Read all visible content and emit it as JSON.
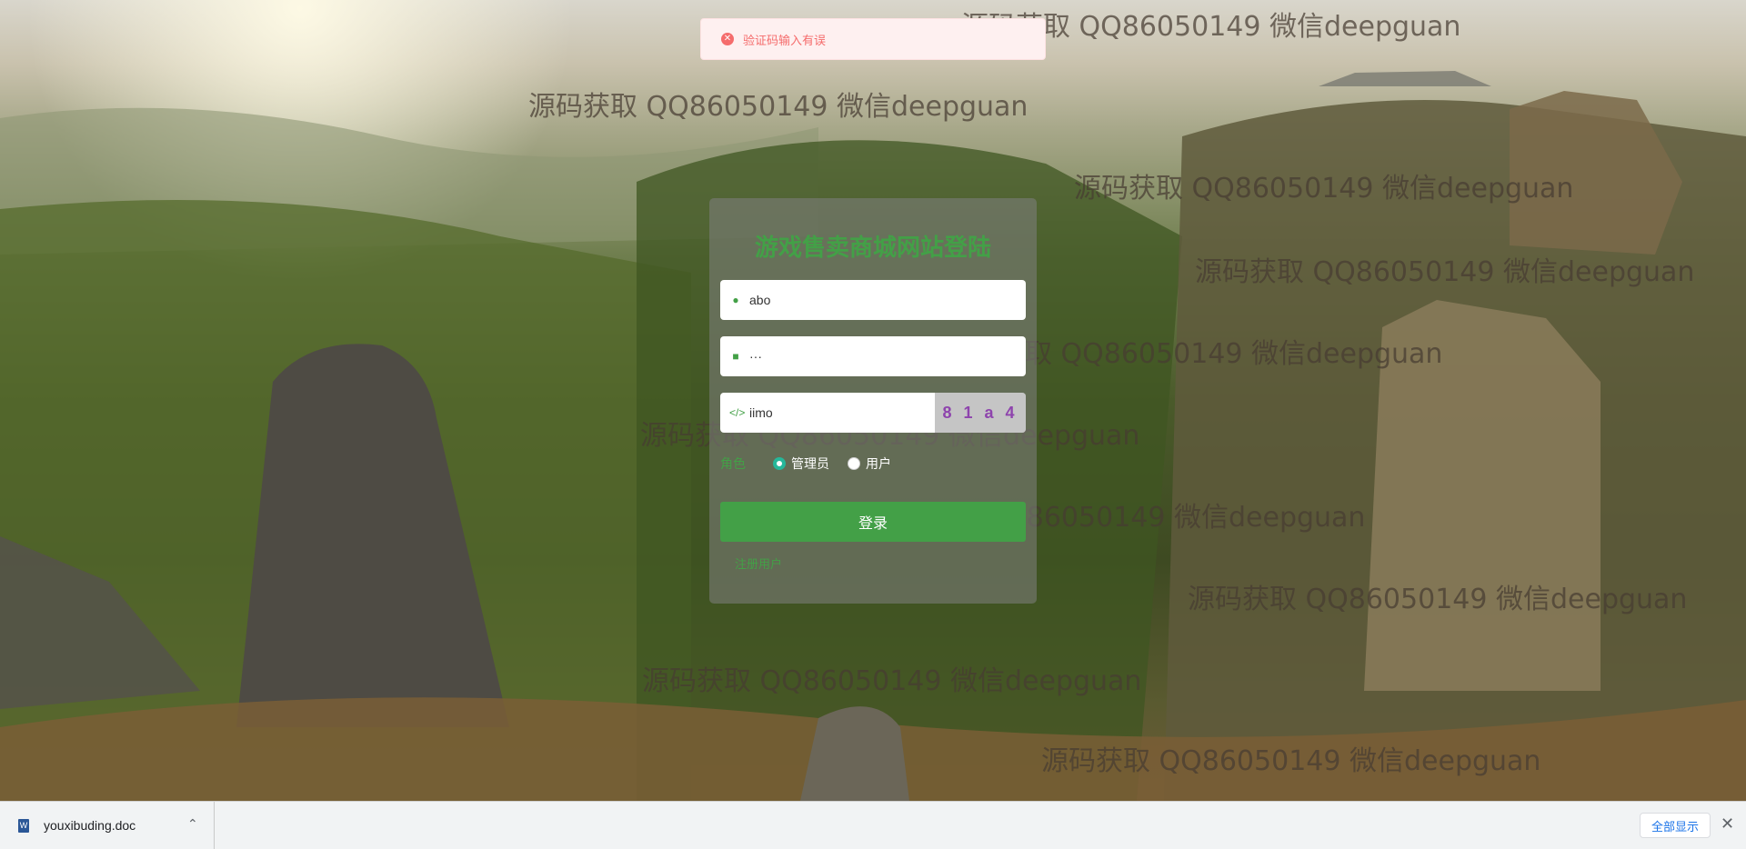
{
  "toast": {
    "icon": "error-circle-icon",
    "message": "验证码输入有误"
  },
  "login": {
    "title": "游戏售卖商城网站登陆",
    "username_value": "abo",
    "password_value": "···",
    "captcha_value": "iimo",
    "captcha_image_text": "8 1 a 4",
    "role_label": "角色",
    "roles": [
      {
        "label": "管理员",
        "checked": true
      },
      {
        "label": "用户",
        "checked": false
      }
    ],
    "login_button": "登录",
    "register_link": "注册用户"
  },
  "watermarks": [
    "源码获取 QQ86050149 微信deepguan",
    "源码获取 QQ86050149 微信deepguan",
    "源码获取 QQ86050149 微信deepguan",
    "源码获取 QQ86050149 微信deepguan",
    "源码获取 QQ86050149 微信deepguan",
    "源码获取 QQ86050149 微信deepguan",
    "源码获取 QQ86050149 微信deepguan",
    "源码获取 QQ86050149 微信deepguan",
    "源码获取 QQ86050149 微信deepguan",
    "源码获取 QQ86050149 微信deepguan"
  ],
  "download_bar": {
    "file_name": "youxibuding.doc",
    "show_all": "全部显示",
    "close_icon": "close-icon",
    "chevron_icon": "chevron-up-icon"
  },
  "colors": {
    "accent_green": "#43a047",
    "error_red": "#f56c6c",
    "radio_checked": "#26b79a"
  }
}
